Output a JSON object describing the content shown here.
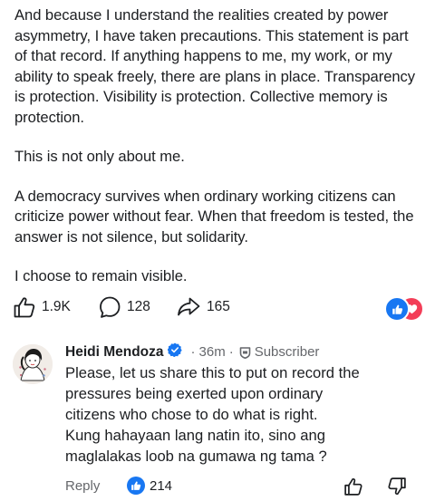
{
  "post": {
    "paragraphs": [
      "And because I understand the realities created by power asymmetry, I have taken precautions. This statement is part of that record. If anything happens to me, my work, or my ability to speak freely, there are plans in place. Transparency is protection. Visibility is protection. Collective memory is protection.",
      "This is not only about me.",
      "A democracy survives when ordinary working citizens can criticize power without fear. When that freedom is tested, the answer is not silence, but solidarity.",
      "I choose to remain visible."
    ]
  },
  "actions": {
    "likes": "1.9K",
    "comments": "128",
    "shares": "165",
    "reaction_icons": [
      "like-reaction-icon",
      "love-reaction-icon"
    ]
  },
  "comment": {
    "author": "Heidi Mendoza",
    "time": "36m",
    "badge": "Subscriber",
    "body_lines": [
      "Please, let us share this to put on record the",
      "pressures being exerted upon ordinary",
      "citizens who chose to do what is right.",
      "Kung hahayaan lang natin ito, sino ang",
      "maglalakas loob na gumawa ng tama ?"
    ],
    "reply_label": "Reply",
    "like_count": "214"
  },
  "colors": {
    "brand_blue": "#1877f2",
    "love_red": "#f33e58",
    "meta_gray": "#65676b",
    "text": "#1c1e21"
  }
}
